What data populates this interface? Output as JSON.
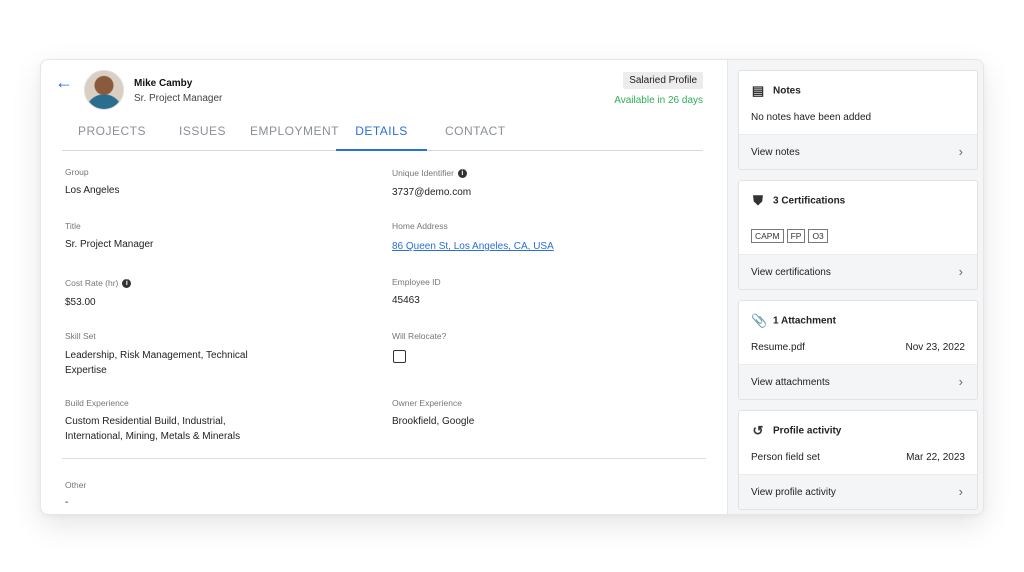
{
  "profile": {
    "name": "Mike Camby",
    "role": "Sr. Project Manager",
    "badge": "Salaried Profile",
    "availability": "Available in 26 days",
    "back_icon": "arrow-left-icon"
  },
  "tabs": [
    {
      "label": "PROJECTS",
      "active": false
    },
    {
      "label": "ISSUES",
      "active": false
    },
    {
      "label": "EMPLOYMENT",
      "active": false
    },
    {
      "label": "DETAILS",
      "active": true
    },
    {
      "label": "CONTACT",
      "active": false
    }
  ],
  "fields": {
    "group": {
      "label": "Group",
      "value": "Los Angeles"
    },
    "unique_identifier": {
      "label": "Unique Identifier",
      "value": "3737@demo.com"
    },
    "title": {
      "label": "Title",
      "value": "Sr. Project Manager"
    },
    "home_address": {
      "label": "Home Address",
      "value": "86 Queen St, Los Angeles, CA, USA"
    },
    "cost_rate": {
      "label": "Cost Rate (hr)",
      "value": "$53.00"
    },
    "employee_id": {
      "label": "Employee ID",
      "value": "45463"
    },
    "skill_set": {
      "label": "Skill Set",
      "value": "Leadership, Risk Management, Technical Expertise"
    },
    "will_relocate": {
      "label": "Will Relocate?",
      "checked": false
    },
    "build_experience": {
      "label": "Build Experience",
      "value": "Custom Residential Build, Industrial, International, Mining, Metals & Minerals"
    },
    "owner_experience": {
      "label": "Owner Experience",
      "value": "Brookfield, Google"
    },
    "other": {
      "label": "Other",
      "value": "-"
    }
  },
  "info_glyph": "i",
  "sidebar": {
    "notes": {
      "title": "Notes",
      "body": "No notes have been added",
      "footer": "View notes",
      "icon": "notes-icon"
    },
    "certifications": {
      "title": "3 Certifications",
      "tags": [
        "CAPM",
        "FP",
        "O3"
      ],
      "footer": "View certifications",
      "icon": "certificate-icon"
    },
    "attachments": {
      "title": "1 Attachment",
      "file": "Resume.pdf",
      "date": "Nov 23, 2022",
      "footer": "View attachments",
      "icon": "paperclip-icon"
    },
    "activity": {
      "title": "Profile activity",
      "item": "Person field set",
      "date": "Mar 22, 2023",
      "footer": "View profile activity",
      "icon": "history-icon"
    }
  },
  "colors": {
    "accent": "#2a6edb",
    "available": "#2fae57",
    "sidebar_bg": "#f4f5f6"
  }
}
